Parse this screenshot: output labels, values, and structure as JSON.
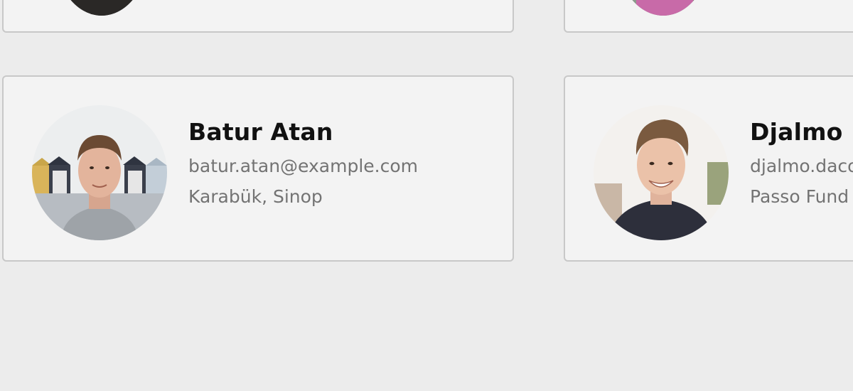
{
  "users": [
    {
      "name": "Batur Atan",
      "email": "batur.atan@example.com",
      "location": "Karabük, Sinop"
    },
    {
      "name": "Djalmo D",
      "email": "djalmo.daco",
      "location": "Passo Fund"
    }
  ]
}
